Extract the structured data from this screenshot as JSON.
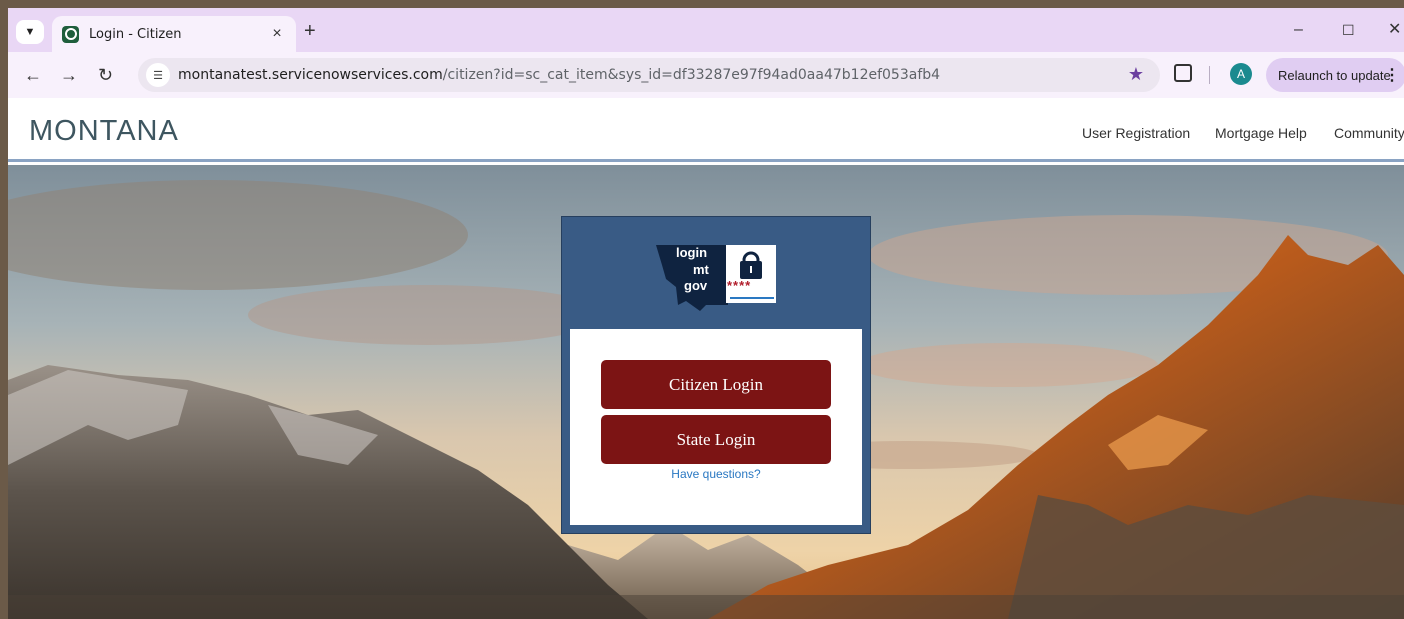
{
  "browser": {
    "tab_title": "Login - Citizen",
    "tab_close": "×",
    "new_tab": "+",
    "url_domain": "montanatest.servicenowservices.com",
    "url_path": "/citizen?id=sc_cat_item&sys_id=df33287e97f94ad0aa47b12ef053afb4",
    "profile_initial": "A",
    "relaunch_label": "Relaunch to update",
    "minimize": "–",
    "maximize": "☐",
    "close": "✕"
  },
  "site": {
    "title": "MONTANA",
    "nav": [
      "User Registration",
      "Mortgage Help",
      "Community"
    ]
  },
  "login": {
    "logo_lines": [
      "login",
      "mt",
      "gov"
    ],
    "logo_asterisks": "****",
    "citizen_login": "Citizen Login",
    "state_login": "State Login",
    "help": "Have questions?"
  },
  "colors": {
    "tabstrip": "#e9d7f5",
    "panel_blue": "#395b85",
    "button_red": "#7c1414",
    "link_blue": "#2a78c2",
    "title_slate": "#3e5660"
  }
}
